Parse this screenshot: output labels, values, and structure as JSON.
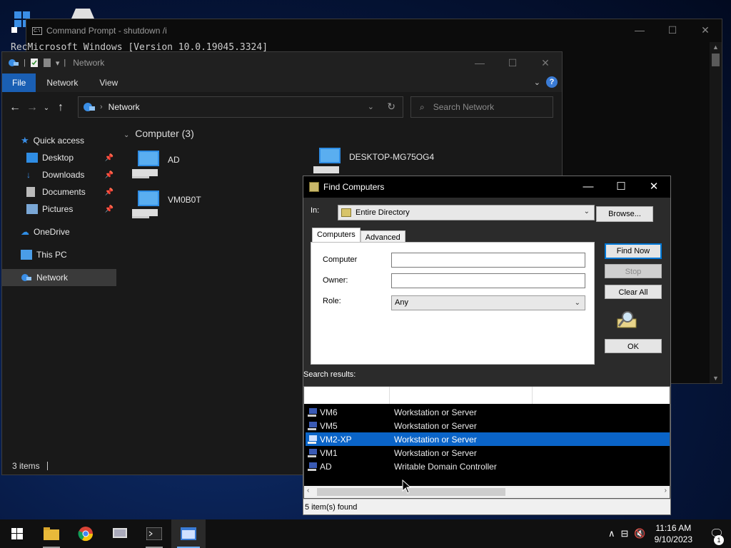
{
  "colors": {
    "accent": "#0078d7",
    "selection": "#0a64c8",
    "file_tab": "#1a5fb4"
  },
  "cmd": {
    "title": "Command Prompt - shutdown  /i",
    "text": "RecMicrosoft Windows [Version 10.0.19045.3324]",
    "minimize": "—",
    "maximize": "☐",
    "close": "✕"
  },
  "explorer": {
    "title": "Network",
    "ribbon": {
      "file": "File",
      "network": "Network",
      "view": "View"
    },
    "address": {
      "crumb": "Network"
    },
    "search": {
      "placeholder": "Search Network"
    },
    "nav": {
      "quick_access": "Quick access",
      "desktop": "Desktop",
      "downloads": "Downloads",
      "documents": "Documents",
      "pictures": "Pictures",
      "onedrive": "OneDrive",
      "this_pc": "This PC",
      "network": "Network"
    },
    "group_header": "Computer (3)",
    "computers": [
      "AD",
      "DESKTOP-MG75OG4",
      "VM0B0T"
    ],
    "status": "3 items"
  },
  "dialog": {
    "title": "Find Computers",
    "in_label": "In:",
    "in_value": "Entire Directory",
    "browse": "Browse...",
    "tabs": {
      "computers": "Computers",
      "advanced": "Advanced"
    },
    "fields": {
      "computer": "Computer",
      "owner": "Owner:",
      "role": "Role:"
    },
    "role_value": "Any",
    "buttons": {
      "find_now": "Find Now",
      "stop": "Stop",
      "clear_all": "Clear All",
      "ok": "OK"
    },
    "results_label": "Search results:",
    "results": [
      {
        "name": "VM6",
        "role": "Workstation or Server"
      },
      {
        "name": "VM5",
        "role": "Workstation or Server"
      },
      {
        "name": "VM2-XP",
        "role": "Workstation or Server"
      },
      {
        "name": "VM1",
        "role": "Workstation or Server"
      },
      {
        "name": "AD",
        "role": "Writable Domain Controller"
      }
    ],
    "selected_result": "VM2-XP",
    "status": "5 item(s) found"
  },
  "taskbar": {
    "time": "11:16 AM",
    "date": "9/10/2023",
    "notifications": "1"
  }
}
